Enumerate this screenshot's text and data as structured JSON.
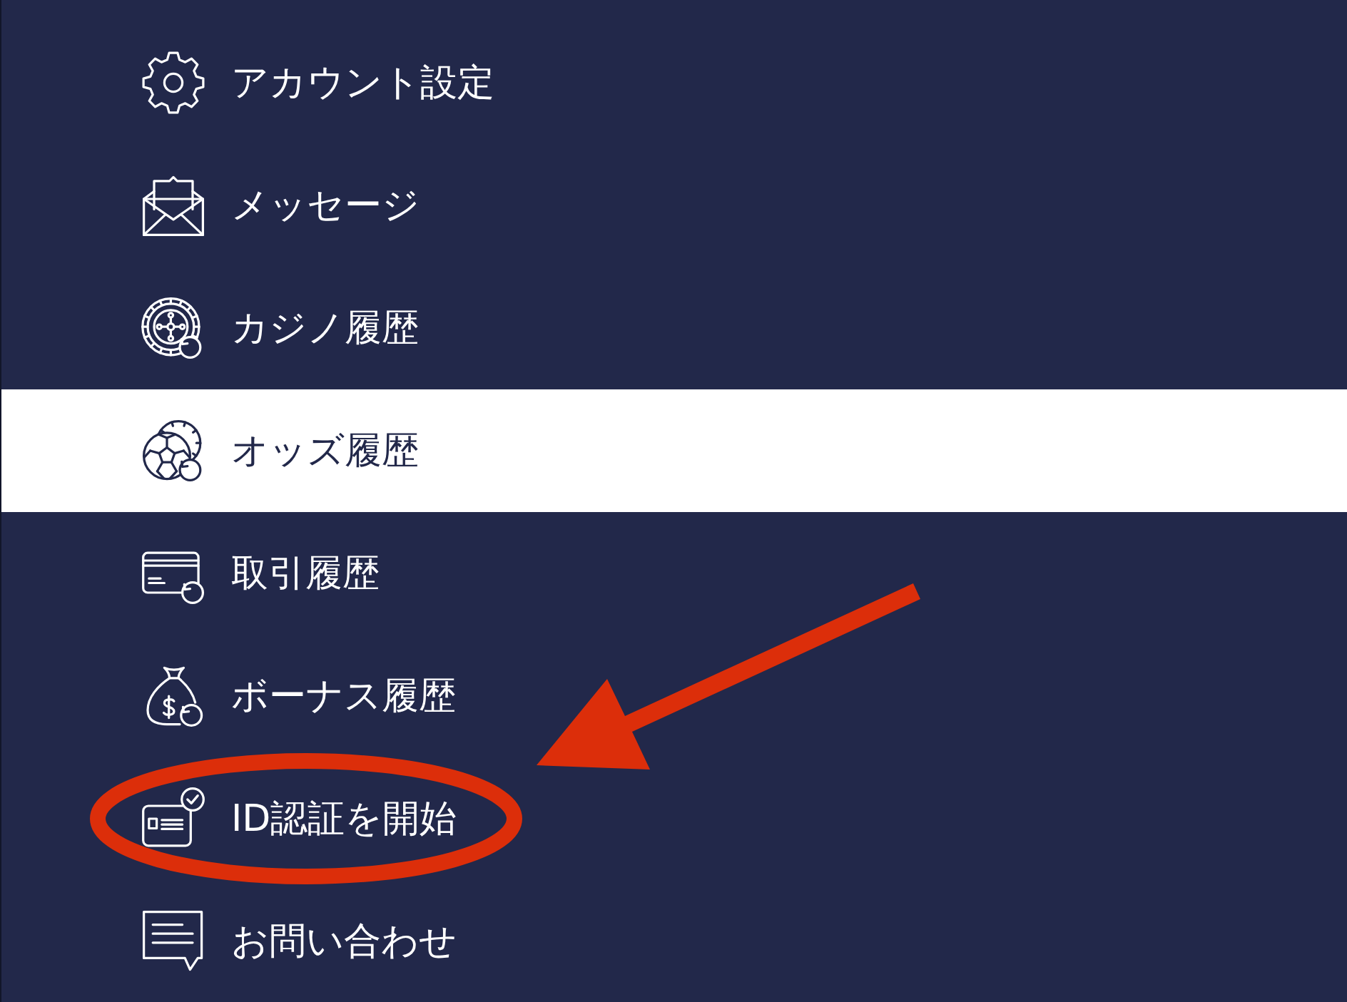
{
  "menu": {
    "items": [
      {
        "label": "アカウント設定",
        "selected": false,
        "circled": false
      },
      {
        "label": "メッセージ",
        "selected": false,
        "circled": false
      },
      {
        "label": "カジノ履歴",
        "selected": false,
        "circled": false
      },
      {
        "label": "オッズ履歴",
        "selected": true,
        "circled": false
      },
      {
        "label": "取引履歴",
        "selected": false,
        "circled": false
      },
      {
        "label": "ボーナス履歴",
        "selected": false,
        "circled": false
      },
      {
        "label": "ID認証を開始",
        "selected": false,
        "circled": true
      },
      {
        "label": "お問い合わせ",
        "selected": false,
        "circled": false
      }
    ]
  },
  "pointer_arrow": true
}
